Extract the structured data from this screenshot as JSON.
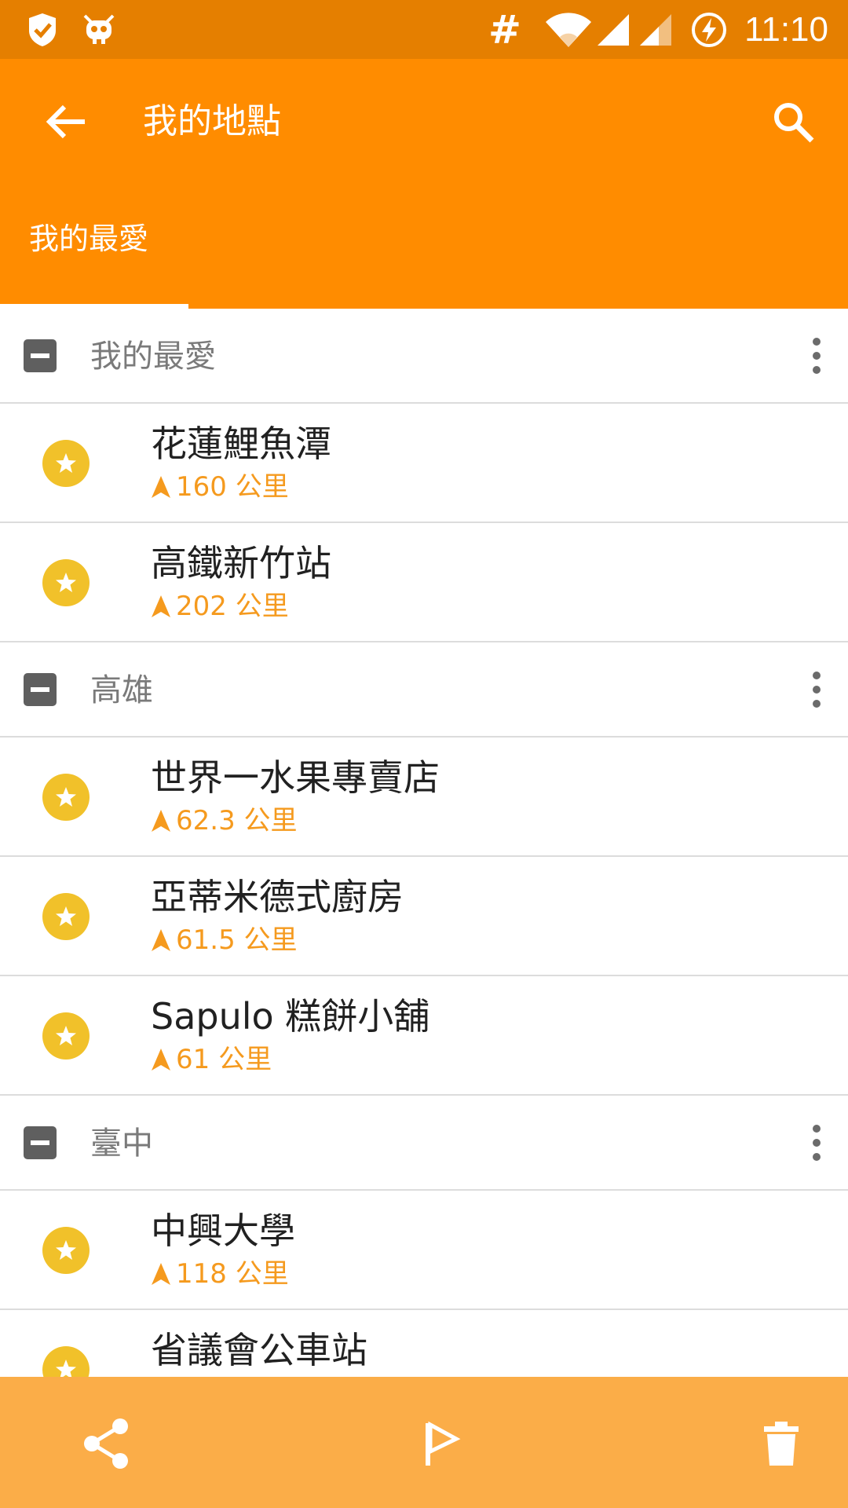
{
  "status_bar": {
    "time": "11:10",
    "hash_symbol": "#",
    "icons": [
      "shield-check-icon",
      "bug-icon",
      "hash-icon",
      "wifi-icon",
      "signal-icon",
      "signal-icon",
      "battery-charging-icon"
    ]
  },
  "app_bar": {
    "title": "我的地點",
    "back_icon": "arrow-left-icon",
    "search_icon": "search-icon"
  },
  "tabs": [
    {
      "label": "我的最愛",
      "selected": true
    }
  ],
  "groups": [
    {
      "name": "我的最愛",
      "items": [
        {
          "name": "花蓮鯉魚潭",
          "distance": "160 公里"
        },
        {
          "name": "高鐵新竹站",
          "distance": "202 公里"
        }
      ]
    },
    {
      "name": "高雄",
      "items": [
        {
          "name": "世界一水果專賣店",
          "distance": "62.3 公里"
        },
        {
          "name": "亞蒂米德式廚房",
          "distance": "61.5 公里"
        },
        {
          "name": "Sapulo 糕餅小舖",
          "distance": "61 公里"
        }
      ]
    },
    {
      "name": "臺中",
      "items": [
        {
          "name": "中興大學",
          "distance": "118 公里"
        },
        {
          "name": "省議會公車站",
          "distance": ""
        }
      ]
    }
  ],
  "bottom_bar": {
    "actions": [
      "share-icon",
      "flag-icon",
      "trash-icon"
    ]
  },
  "colors": {
    "status_bar": "#e57f00",
    "app_bar": "#ff8c00",
    "bottom_bar": "#fbad48",
    "accent_distance": "#f59a1e",
    "star": "#f1c12a"
  }
}
